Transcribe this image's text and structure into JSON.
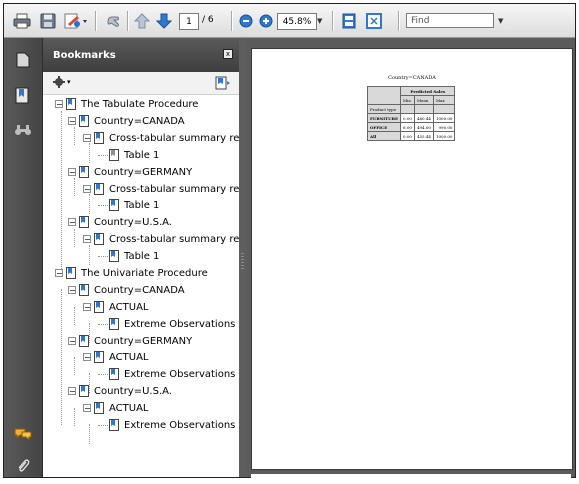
{
  "toolbar": {
    "page_current": "1",
    "page_total": "/ 6",
    "zoom": "45.8%",
    "find_placeholder": "Find"
  },
  "bookmarks": {
    "title": "Bookmarks",
    "close": "x",
    "tree": [
      {
        "label": "The Tabulate Procedure",
        "level": 0,
        "icon": "bookmark-icon"
      },
      {
        "label": "Country=CANADA",
        "level": 1,
        "icon": "bookmark-icon"
      },
      {
        "label": "Cross-tabular summary report",
        "level": 2,
        "icon": "bookmark-icon"
      },
      {
        "label": "Table 1",
        "level": 3,
        "icon": "bookmark-gray-icon"
      },
      {
        "label": "Country=GERMANY",
        "level": 1,
        "icon": "bookmark-icon"
      },
      {
        "label": "Cross-tabular summary report",
        "level": 2,
        "icon": "bookmark-icon"
      },
      {
        "label": "Table 1",
        "level": 3,
        "icon": "bookmark-icon"
      },
      {
        "label": "Country=U.S.A.",
        "level": 1,
        "icon": "bookmark-icon"
      },
      {
        "label": "Cross-tabular summary report",
        "level": 2,
        "icon": "bookmark-icon"
      },
      {
        "label": "Table 1",
        "level": 3,
        "icon": "bookmark-icon"
      },
      {
        "label": "The Univariate Procedure",
        "level": 0,
        "icon": "bookmark-icon"
      },
      {
        "label": "Country=CANADA",
        "level": 1,
        "icon": "bookmark-icon"
      },
      {
        "label": "ACTUAL",
        "level": 2,
        "icon": "bookmark-icon"
      },
      {
        "label": "Extreme Observations",
        "level": 3,
        "icon": "bookmark-icon"
      },
      {
        "label": "Country=GERMANY",
        "level": 1,
        "icon": "bookmark-icon"
      },
      {
        "label": "ACTUAL",
        "level": 2,
        "icon": "bookmark-icon"
      },
      {
        "label": "Extreme Observations",
        "level": 3,
        "icon": "bookmark-icon"
      },
      {
        "label": "Country=U.S.A.",
        "level": 1,
        "icon": "bookmark-icon"
      },
      {
        "label": "ACTUAL",
        "level": 2,
        "icon": "bookmark-icon"
      },
      {
        "label": "Extreme Observations",
        "level": 3,
        "icon": "bookmark-icon"
      }
    ]
  },
  "document": {
    "title": "Country=CANADA",
    "table": {
      "group_header": "Predicted Sales",
      "columns": [
        "Min",
        "Mean",
        "Max"
      ],
      "row_header": "Product type",
      "rows": [
        {
          "label": "FURNITURE",
          "values": [
            "0.00",
            "460.44",
            "1000.00"
          ]
        },
        {
          "label": "OFFICE",
          "values": [
            "6.00",
            "494.00",
            "990.00"
          ]
        },
        {
          "label": "All",
          "values": [
            "0.00",
            "455.44",
            "1000.00"
          ]
        }
      ]
    }
  }
}
